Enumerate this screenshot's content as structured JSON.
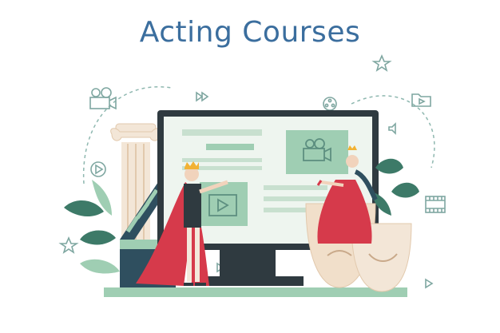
{
  "title": "Acting Courses",
  "colors": {
    "title": "#3b6e9e",
    "accent_green": "#9fceb3",
    "monitor_dark": "#2f3a40",
    "screen": "#e3efe6",
    "robe_red": "#d63a4b",
    "mask_beige": "#f1dfca",
    "leaf_green": "#3d7a68",
    "column": "#f3e6d7",
    "icon_line": "#7fa7a1"
  },
  "icons": [
    "video-camera-icon",
    "play-icon",
    "fast-forward-icon",
    "film-reel-icon",
    "folder-video-icon",
    "star-icon",
    "volume-icon",
    "filmstrip-icon"
  ]
}
